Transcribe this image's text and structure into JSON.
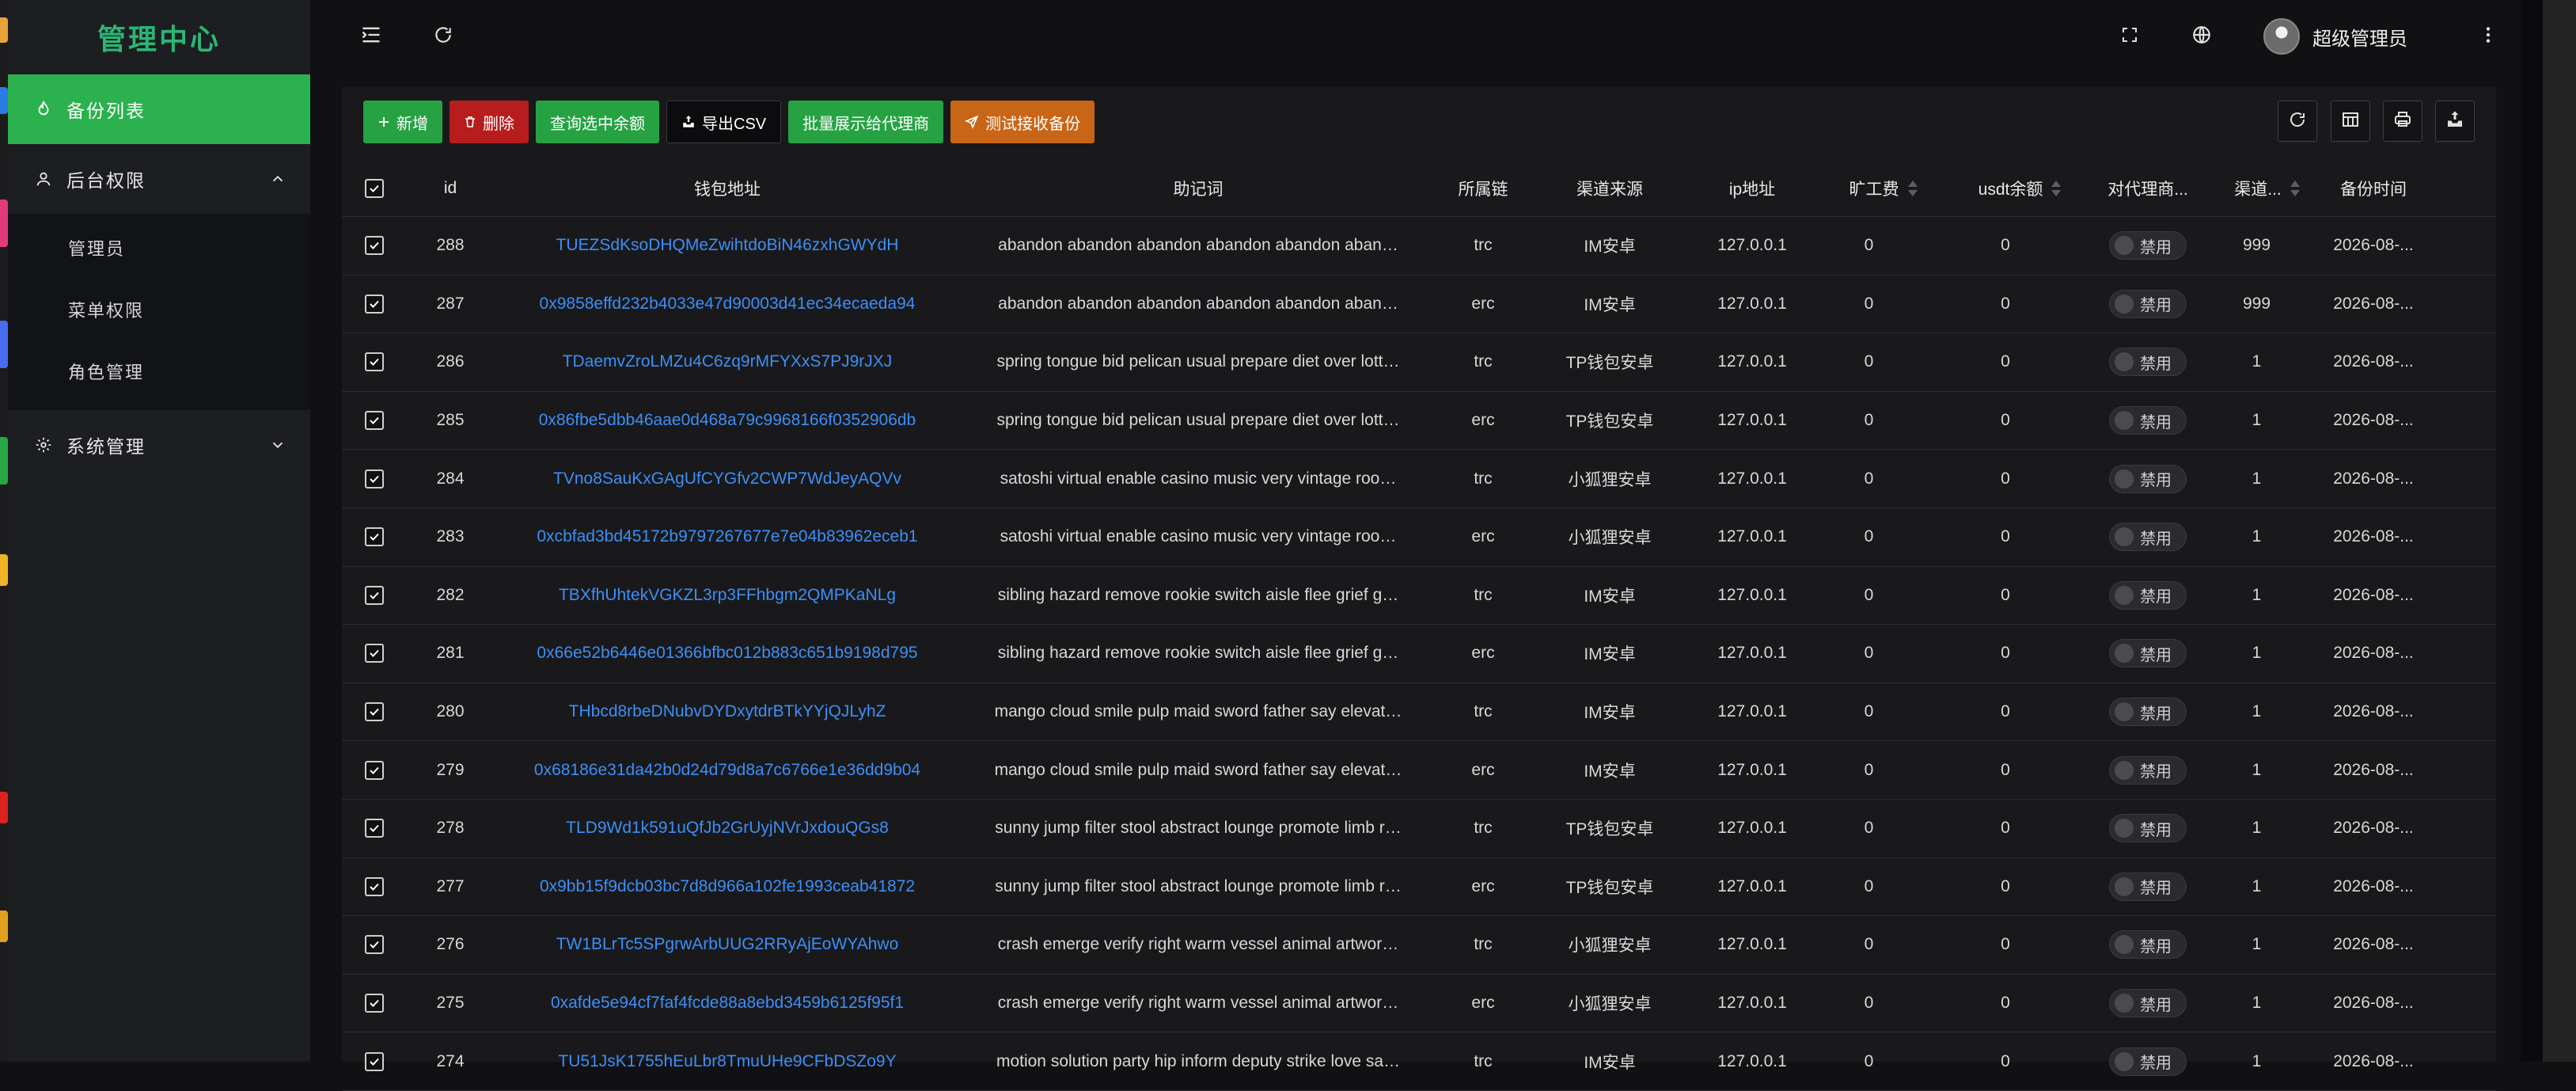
{
  "app": {
    "title": "管理中心"
  },
  "sidebar": {
    "items": [
      {
        "label": "备份列表",
        "icon": "fire-icon",
        "active": true
      },
      {
        "label": "后台权限",
        "icon": "user-icon",
        "expanded": true,
        "children": [
          {
            "label": "管理员"
          },
          {
            "label": "菜单权限"
          },
          {
            "label": "角色管理"
          }
        ]
      },
      {
        "label": "系统管理",
        "icon": "gear-icon",
        "expanded": false
      }
    ]
  },
  "header": {
    "username": "超级管理员",
    "icons": [
      "menu-fold-icon",
      "refresh-icon",
      "fullscreen-icon",
      "globe-icon",
      "more-icon"
    ]
  },
  "toolbar": {
    "add": "新增",
    "delete": "删除",
    "query_balance": "查询选中余额",
    "export_csv": "导出CSV",
    "batch_show": "批量展示给代理商",
    "test_receive": "测试接收备份",
    "right_icons": [
      "refresh-icon",
      "columns-icon",
      "print-icon",
      "export-icon"
    ]
  },
  "colors": {
    "accent": "#2bb14e",
    "brand_title": "#2bb673",
    "link": "#3d8ff5",
    "danger": "#b81d1d",
    "warning": "#c96516"
  },
  "table": {
    "columns": [
      "id",
      "钱包地址",
      "助记词",
      "所属链",
      "渠道来源",
      "ip地址",
      "旷工费",
      "usdt余额",
      "对代理商...",
      "渠道...",
      "备份时间"
    ],
    "rows": [
      {
        "id": "288",
        "address": "TUEZSdKsoDHQMeZwihtdoBiN46zxhGWYdH",
        "mnemonic": "abandon abandon abandon abandon abandon aban…",
        "chain": "trc",
        "source": "IM安卓",
        "ip": "127.0.0.1",
        "fee": "0",
        "usdt": "0",
        "status": "禁用",
        "channel": "999",
        "time": "2026-08-..."
      },
      {
        "id": "287",
        "address": "0x9858effd232b4033e47d90003d41ec34ecaeda94",
        "mnemonic": "abandon abandon abandon abandon abandon aban…",
        "chain": "erc",
        "source": "IM安卓",
        "ip": "127.0.0.1",
        "fee": "0",
        "usdt": "0",
        "status": "禁用",
        "channel": "999",
        "time": "2026-08-..."
      },
      {
        "id": "286",
        "address": "TDaemvZroLMZu4C6zq9rMFYXxS7PJ9rJXJ",
        "mnemonic": "spring tongue bid pelican usual prepare diet over lott…",
        "chain": "trc",
        "source": "TP钱包安卓",
        "ip": "127.0.0.1",
        "fee": "0",
        "usdt": "0",
        "status": "禁用",
        "channel": "1",
        "time": "2026-08-..."
      },
      {
        "id": "285",
        "address": "0x86fbe5dbb46aae0d468a79c9968166f0352906db",
        "mnemonic": "spring tongue bid pelican usual prepare diet over lott…",
        "chain": "erc",
        "source": "TP钱包安卓",
        "ip": "127.0.0.1",
        "fee": "0",
        "usdt": "0",
        "status": "禁用",
        "channel": "1",
        "time": "2026-08-..."
      },
      {
        "id": "284",
        "address": "TVno8SauKxGAgUfCYGfv2CWP7WdJeyAQVv",
        "mnemonic": "satoshi virtual enable casino music very vintage roo…",
        "chain": "trc",
        "source": "小狐狸安卓",
        "ip": "127.0.0.1",
        "fee": "0",
        "usdt": "0",
        "status": "禁用",
        "channel": "1",
        "time": "2026-08-..."
      },
      {
        "id": "283",
        "address": "0xcbfad3bd45172b9797267677e7e04b83962eceb1",
        "mnemonic": "satoshi virtual enable casino music very vintage roo…",
        "chain": "erc",
        "source": "小狐狸安卓",
        "ip": "127.0.0.1",
        "fee": "0",
        "usdt": "0",
        "status": "禁用",
        "channel": "1",
        "time": "2026-08-..."
      },
      {
        "id": "282",
        "address": "TBXfhUhtekVGKZL3rp3FFhbgm2QMPKaNLg",
        "mnemonic": "sibling hazard remove rookie switch aisle flee grief g…",
        "chain": "trc",
        "source": "IM安卓",
        "ip": "127.0.0.1",
        "fee": "0",
        "usdt": "0",
        "status": "禁用",
        "channel": "1",
        "time": "2026-08-..."
      },
      {
        "id": "281",
        "address": "0x66e52b6446e01366bfbc012b883c651b9198d795",
        "mnemonic": "sibling hazard remove rookie switch aisle flee grief g…",
        "chain": "erc",
        "source": "IM安卓",
        "ip": "127.0.0.1",
        "fee": "0",
        "usdt": "0",
        "status": "禁用",
        "channel": "1",
        "time": "2026-08-..."
      },
      {
        "id": "280",
        "address": "THbcd8rbeDNubvDYDxytdrBTkYYjQJLyhZ",
        "mnemonic": "mango cloud smile pulp maid sword father say elevat…",
        "chain": "trc",
        "source": "IM安卓",
        "ip": "127.0.0.1",
        "fee": "0",
        "usdt": "0",
        "status": "禁用",
        "channel": "1",
        "time": "2026-08-..."
      },
      {
        "id": "279",
        "address": "0x68186e31da42b0d24d79d8a7c6766e1e36dd9b04",
        "mnemonic": "mango cloud smile pulp maid sword father say elevat…",
        "chain": "erc",
        "source": "IM安卓",
        "ip": "127.0.0.1",
        "fee": "0",
        "usdt": "0",
        "status": "禁用",
        "channel": "1",
        "time": "2026-08-..."
      },
      {
        "id": "278",
        "address": "TLD9Wd1k591uQfJb2GrUyjNVrJxdouQGs8",
        "mnemonic": "sunny jump filter stool abstract lounge promote limb r…",
        "chain": "trc",
        "source": "TP钱包安卓",
        "ip": "127.0.0.1",
        "fee": "0",
        "usdt": "0",
        "status": "禁用",
        "channel": "1",
        "time": "2026-08-..."
      },
      {
        "id": "277",
        "address": "0x9bb15f9dcb03bc7d8d966a102fe1993ceab41872",
        "mnemonic": "sunny jump filter stool abstract lounge promote limb r…",
        "chain": "erc",
        "source": "TP钱包安卓",
        "ip": "127.0.0.1",
        "fee": "0",
        "usdt": "0",
        "status": "禁用",
        "channel": "1",
        "time": "2026-08-..."
      },
      {
        "id": "276",
        "address": "TW1BLrTc5SPgrwArbUUG2RRyAjEoWYAhwo",
        "mnemonic": "crash emerge verify right warm vessel animal artwor…",
        "chain": "trc",
        "source": "小狐狸安卓",
        "ip": "127.0.0.1",
        "fee": "0",
        "usdt": "0",
        "status": "禁用",
        "channel": "1",
        "time": "2026-08-..."
      },
      {
        "id": "275",
        "address": "0xafde5e94cf7faf4fcde88a8ebd3459b6125f95f1",
        "mnemonic": "crash emerge verify right warm vessel animal artwor…",
        "chain": "erc",
        "source": "小狐狸安卓",
        "ip": "127.0.0.1",
        "fee": "0",
        "usdt": "0",
        "status": "禁用",
        "channel": "1",
        "time": "2026-08-..."
      },
      {
        "id": "274",
        "address": "TU51JsK1755hEuLbr8TmuUHe9CFbDSZo9Y",
        "mnemonic": "motion solution party hip inform deputy strike love sa…",
        "chain": "trc",
        "source": "IM安卓",
        "ip": "127.0.0.1",
        "fee": "0",
        "usdt": "0",
        "status": "禁用",
        "channel": "1",
        "time": "2026-08-..."
      }
    ]
  }
}
